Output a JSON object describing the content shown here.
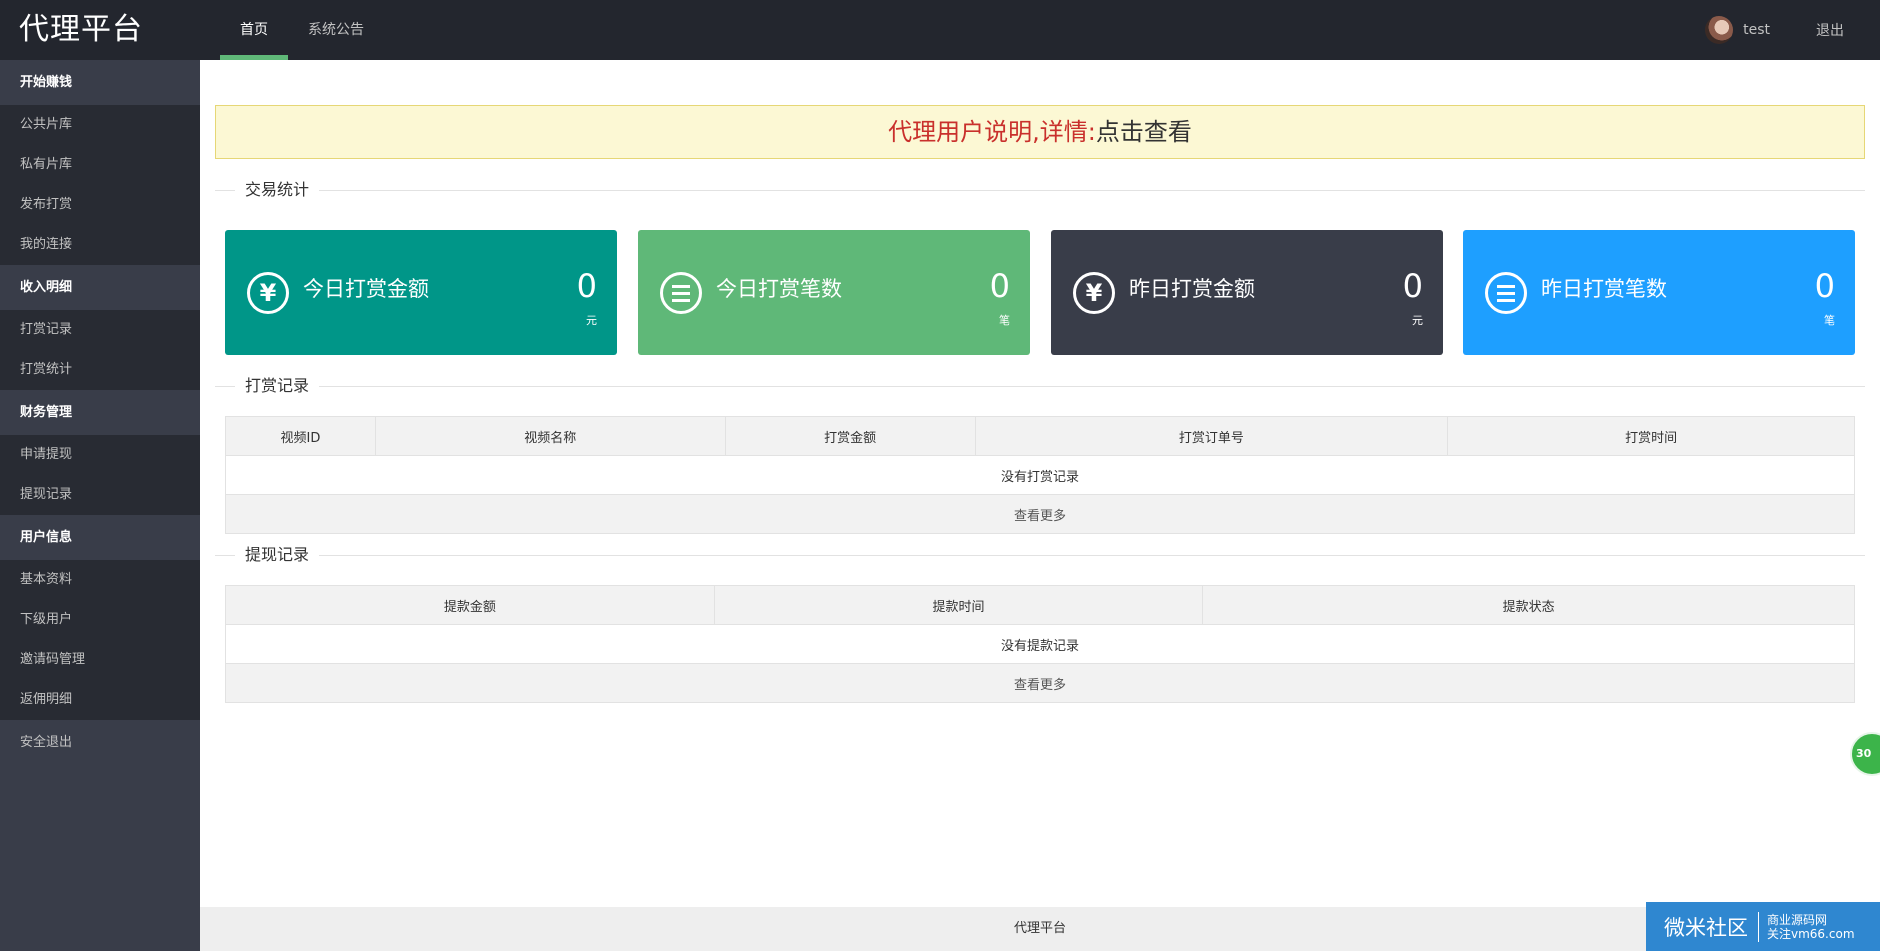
{
  "header": {
    "logo": "代理平台",
    "nav": [
      "首页",
      "系统公告"
    ],
    "username": "test",
    "logout": "退出"
  },
  "sidebar": {
    "groups": [
      {
        "title": "开始赚钱",
        "items": [
          "公共片库",
          "私有片库",
          "发布打赏",
          "我的连接"
        ]
      },
      {
        "title": "收入明细",
        "items": [
          "打赏记录",
          "打赏统计"
        ]
      },
      {
        "title": "财务管理",
        "items": [
          "申请提现",
          "提现记录"
        ]
      },
      {
        "title": "用户信息",
        "items": [
          "基本资料",
          "下级用户",
          "邀请码管理",
          "返佣明细"
        ]
      }
    ],
    "safe_exit": "安全退出"
  },
  "notice": {
    "red_text": "代理用户说明,详情:",
    "link_text": "点击查看"
  },
  "sections": {
    "stats": "交易统计",
    "reward_records": "打赏记录",
    "withdraw_records": "提现记录"
  },
  "cards": [
    {
      "label": "今日打赏金额",
      "value": "0",
      "unit": "元",
      "icon": "yen-circle-icon",
      "color": "#009688"
    },
    {
      "label": "今日打赏笔数",
      "value": "0",
      "unit": "笔",
      "icon": "list-circle-icon",
      "color": "#5fb878"
    },
    {
      "label": "昨日打赏金额",
      "value": "0",
      "unit": "元",
      "icon": "yen-circle-icon",
      "color": "#393d49"
    },
    {
      "label": "昨日打赏笔数",
      "value": "0",
      "unit": "笔",
      "icon": "list-circle-icon",
      "color": "#1e9fff"
    }
  ],
  "reward_table": {
    "headers": [
      "视频ID",
      "视频名称",
      "打赏金额",
      "打赏订单号",
      "打赏时间"
    ],
    "empty": "没有打赏记录",
    "more": "查看更多"
  },
  "withdraw_table": {
    "headers": [
      "提款金额",
      "提款时间",
      "提款状态"
    ],
    "empty": "没有提款记录",
    "more": "查看更多"
  },
  "float_badge": "30",
  "footer": "代理平台",
  "watermark": {
    "main": "微米社区",
    "sub1": "商业源码网",
    "sub2": "关注vm66.com"
  }
}
